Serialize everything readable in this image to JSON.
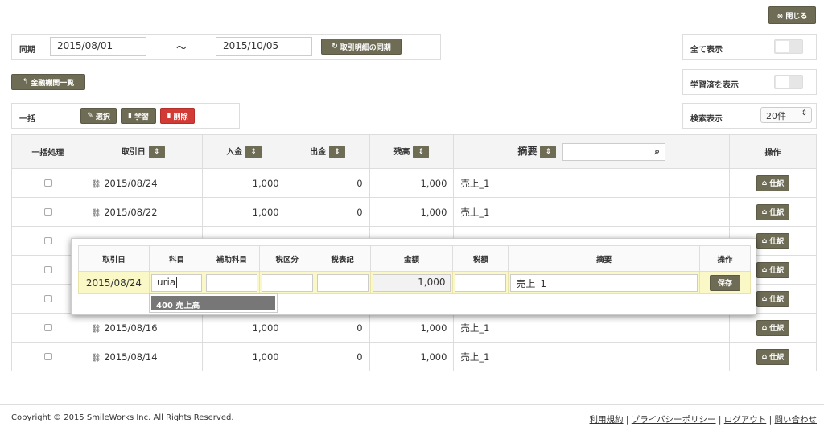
{
  "close_btn": "⊗ 閉じる",
  "period": {
    "label": "同期",
    "from": "2015/08/01",
    "sep": "〜",
    "to": "2015/10/05",
    "sync_btn": "取引明細の同期"
  },
  "show_all": {
    "label": "全て表示"
  },
  "show_learned": {
    "label": "学習済を表示"
  },
  "bank_list_btn": "金融機関一覧",
  "bulk": {
    "label": "一括",
    "select": "選択",
    "learn": "学習",
    "delete": "削除"
  },
  "search_display": {
    "label": "検索表示",
    "value": "20件"
  },
  "table": {
    "headers": {
      "bulk": "一括処理",
      "date": "取引日",
      "deposit": "入金",
      "withdraw": "出金",
      "balance": "残高",
      "summary": "摘要",
      "ops": "操作"
    },
    "journal_btn": "仕訳",
    "rows": [
      {
        "date": "2015/08/24",
        "deposit": "1,000",
        "withdraw": "0",
        "balance": "1,000",
        "summary": "売上_1"
      },
      {
        "date": "2015/08/22",
        "deposit": "1,000",
        "withdraw": "0",
        "balance": "1,000",
        "summary": "売上_1"
      },
      {
        "date": "",
        "deposit": "",
        "withdraw": "",
        "balance": "",
        "summary": ""
      },
      {
        "date": "",
        "deposit": "",
        "withdraw": "",
        "balance": "",
        "summary": ""
      },
      {
        "date": "",
        "deposit": "",
        "withdraw": "",
        "balance": "",
        "summary": ""
      },
      {
        "date": "2015/08/16",
        "deposit": "1,000",
        "withdraw": "0",
        "balance": "1,000",
        "summary": "売上_1"
      },
      {
        "date": "2015/08/14",
        "deposit": "1,000",
        "withdraw": "0",
        "balance": "1,000",
        "summary": "売上_1"
      }
    ]
  },
  "popup": {
    "headers": [
      "取引日",
      "科目",
      "補助科目",
      "税区分",
      "税表記",
      "金額",
      "税額",
      "摘要",
      "操作"
    ],
    "date": "2015/08/24",
    "account": "uria",
    "amount": "1,000",
    "summary": "売上_1",
    "save_btn": "保存",
    "suggestion": "400 売上高"
  },
  "footer": {
    "copyright": "Copyright © 2015 SmileWorks Inc. All Rights Reserved.",
    "links": [
      "利用規約",
      "プライバシーポリシー",
      "ログアウト",
      "問い合わせ"
    ]
  }
}
